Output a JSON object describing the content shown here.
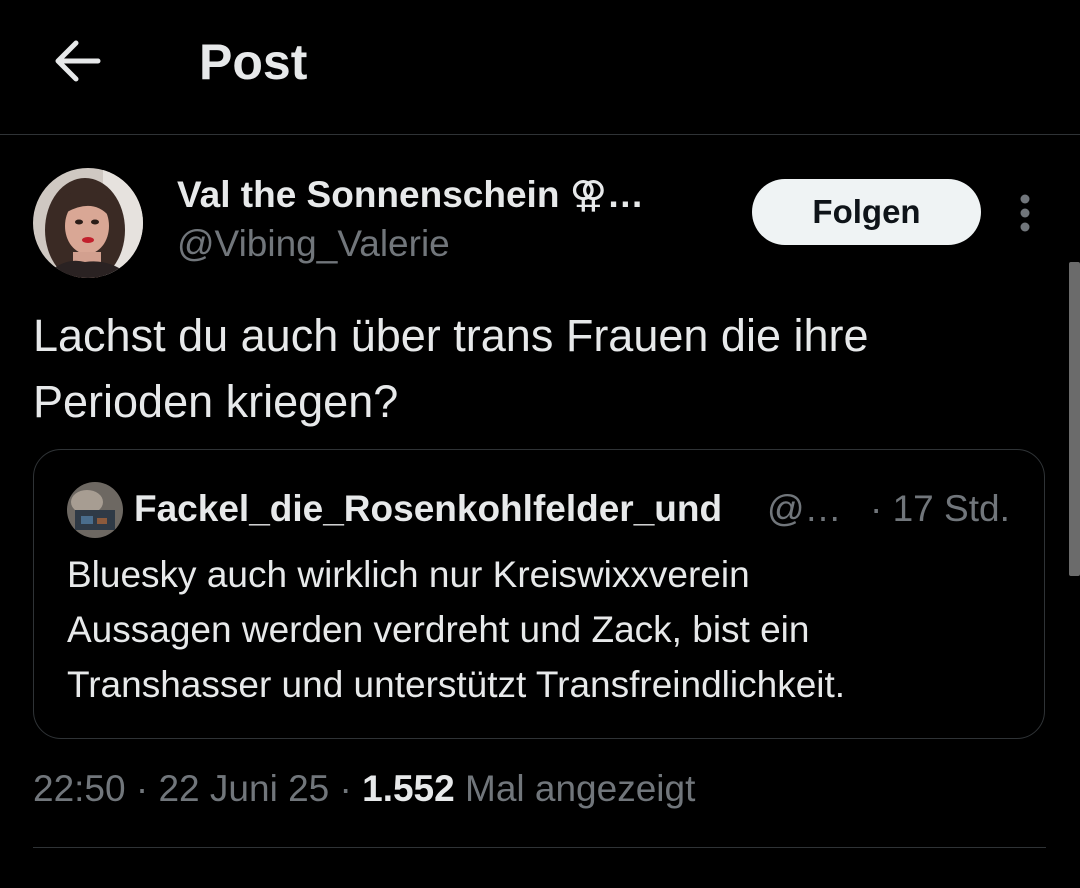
{
  "header": {
    "back_icon": "arrow-left-icon",
    "title": "Post"
  },
  "post": {
    "author": {
      "display_name": "Val the Sonnenschein ⚢…",
      "handle": "@Vibing_Valerie",
      "avatar": "avatar-photo"
    },
    "follow_label": "Folgen",
    "more_icon": "more-vertical-icon",
    "text_lines": [
      "Lachst du auch über trans Frauen die ihre",
      "Perioden kriegen?"
    ],
    "quote": {
      "author_name": "Fackel_die_Rosenkohlfelder_und",
      "author_handle": "@…",
      "time": "· 17 Std.",
      "text_lines": [
        "Bluesky auch wirklich nur Kreiswixxverein",
        "Aussagen werden verdreht und Zack, bist ein",
        "Transhasser und unterstützt Transfreindlichkeit."
      ]
    },
    "meta": {
      "time": "22:50",
      "sep1": " · ",
      "date": "22 Juni 25",
      "sep2": " · ",
      "views": "1.552",
      "views_label": " Mal angezeigt"
    }
  },
  "colors": {
    "background": "#000000",
    "text_primary": "#e7e9ea",
    "text_secondary": "#71767b",
    "border": "#2f3336",
    "follow_bg": "#eff3f4",
    "follow_text": "#0f1419"
  }
}
